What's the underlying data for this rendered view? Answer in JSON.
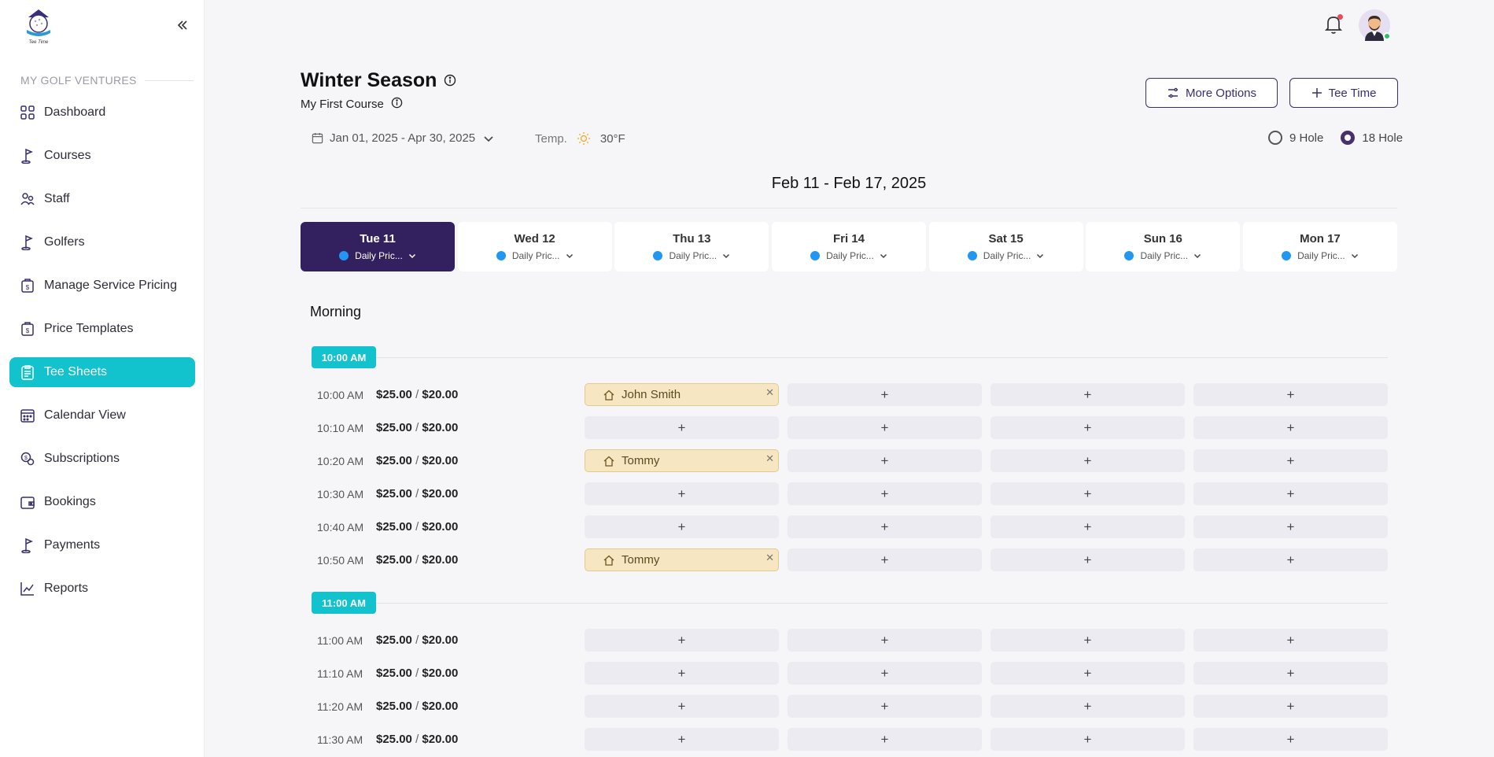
{
  "sidebar": {
    "section_label": "MY GOLF VENTURES",
    "items": [
      {
        "label": "Dashboard",
        "icon": "dashboard-icon"
      },
      {
        "label": "Courses",
        "icon": "golf-flag-icon"
      },
      {
        "label": "Staff",
        "icon": "staff-icon"
      },
      {
        "label": "Golfers",
        "icon": "golf-flag-icon"
      },
      {
        "label": "Manage Service Pricing",
        "icon": "price-tag-icon"
      },
      {
        "label": "Price Templates",
        "icon": "price-tag-icon"
      },
      {
        "label": "Tee Sheets",
        "icon": "clipboard-icon",
        "active": true
      },
      {
        "label": "Calendar View",
        "icon": "calendar-icon"
      },
      {
        "label": "Subscriptions",
        "icon": "subscription-icon"
      },
      {
        "label": "Bookings",
        "icon": "wallet-icon"
      },
      {
        "label": "Payments",
        "icon": "golf-flag-icon"
      },
      {
        "label": "Reports",
        "icon": "chart-line-icon"
      }
    ]
  },
  "header": {
    "title": "Winter Season",
    "subtitle": "My First Course",
    "more_options_label": "More Options",
    "tee_time_label": "Tee Time",
    "date_range": "Jan 01, 2025 - Apr 30, 2025",
    "temp_label": "Temp.",
    "temp_value": "30°F",
    "hole_options": [
      "9 Hole",
      "18 Hole"
    ],
    "selected_hole": "18 Hole"
  },
  "week": {
    "title": "Feb 11 - Feb 17, 2025",
    "days": [
      {
        "name": "Tue 11",
        "price": "Daily Pric...",
        "active": true
      },
      {
        "name": "Wed 12",
        "price": "Daily Pric..."
      },
      {
        "name": "Thu 13",
        "price": "Daily Pric..."
      },
      {
        "name": "Fri 14",
        "price": "Daily Pric..."
      },
      {
        "name": "Sat 15",
        "price": "Daily Pric..."
      },
      {
        "name": "Sun 16",
        "price": "Daily Pric..."
      },
      {
        "name": "Mon 17",
        "price": "Daily Pric..."
      }
    ]
  },
  "sheet": {
    "period": "Morning",
    "hours": [
      {
        "label": "10:00 AM",
        "rows": [
          {
            "time": "10:00 AM",
            "price": "$25.00",
            "alt_price": "$20.00",
            "slots": [
              "John Smith",
              "",
              "",
              ""
            ]
          },
          {
            "time": "10:10 AM",
            "price": "$25.00",
            "alt_price": "$20.00",
            "slots": [
              "",
              "",
              "",
              ""
            ]
          },
          {
            "time": "10:20 AM",
            "price": "$25.00",
            "alt_price": "$20.00",
            "slots": [
              "Tommy",
              "",
              "",
              ""
            ]
          },
          {
            "time": "10:30 AM",
            "price": "$25.00",
            "alt_price": "$20.00",
            "slots": [
              "",
              "",
              "",
              ""
            ]
          },
          {
            "time": "10:40 AM",
            "price": "$25.00",
            "alt_price": "$20.00",
            "slots": [
              "",
              "",
              "",
              ""
            ]
          },
          {
            "time": "10:50 AM",
            "price": "$25.00",
            "alt_price": "$20.00",
            "slots": [
              "Tommy",
              "",
              "",
              ""
            ]
          }
        ]
      },
      {
        "label": "11:00 AM",
        "rows": [
          {
            "time": "11:00 AM",
            "price": "$25.00",
            "alt_price": "$20.00",
            "slots": [
              "",
              "",
              "",
              ""
            ]
          },
          {
            "time": "11:10 AM",
            "price": "$25.00",
            "alt_price": "$20.00",
            "slots": [
              "",
              "",
              "",
              ""
            ]
          },
          {
            "time": "11:20 AM",
            "price": "$25.00",
            "alt_price": "$20.00",
            "slots": [
              "",
              "",
              "",
              ""
            ]
          },
          {
            "time": "11:30 AM",
            "price": "$25.00",
            "alt_price": "$20.00",
            "slots": [
              "",
              "",
              "",
              ""
            ]
          }
        ]
      }
    ],
    "empty_slot_symbol": "+",
    "price_separator": "/"
  },
  "colors": {
    "accent": "#12c2cc",
    "primary": "#33215f",
    "booked_bg": "#f7e6c2",
    "price_dot": "#2196f3"
  }
}
